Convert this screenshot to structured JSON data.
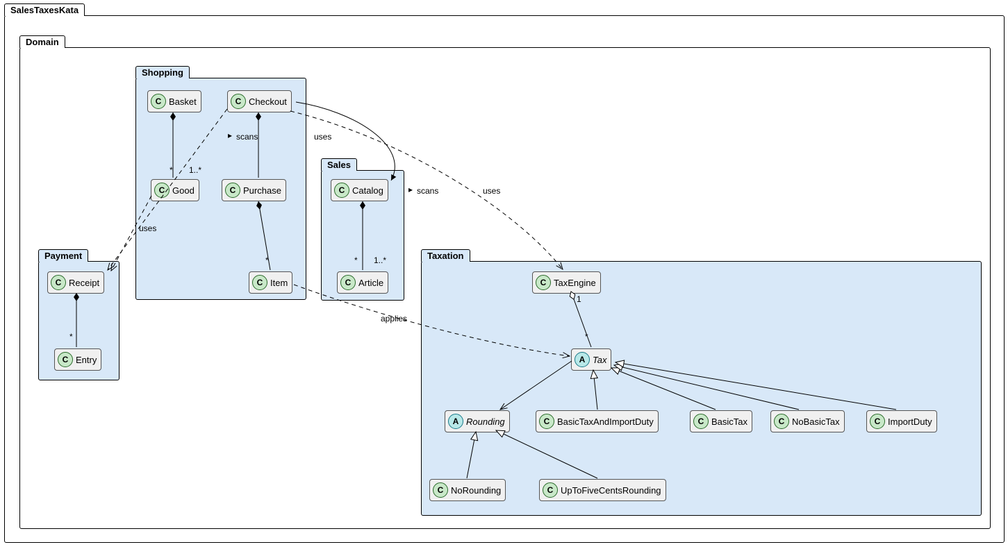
{
  "root_package": "SalesTaxesKata",
  "domain": {
    "label": "Domain"
  },
  "shopping": {
    "label": "Shopping",
    "basket": "Basket",
    "checkout": "Checkout",
    "good": "Good",
    "purchase": "Purchase",
    "item": "Item"
  },
  "sales": {
    "label": "Sales",
    "catalog": "Catalog",
    "article": "Article"
  },
  "payment": {
    "label": "Payment",
    "receipt": "Receipt",
    "entry": "Entry"
  },
  "taxation": {
    "label": "Taxation",
    "taxengine": "TaxEngine",
    "tax": "Tax",
    "rounding": "Rounding",
    "basictaxandimportduty": "BasicTaxAndImportDuty",
    "basictax": "BasicTax",
    "nobasictax": "NoBasicTax",
    "importduty": "ImportDuty",
    "norounding": "NoRounding",
    "upto": "UpToFiveCentsRounding"
  },
  "rel": {
    "scans": "scans",
    "uses": "uses",
    "applies": "applies",
    "star": "*",
    "one_star": "1..*",
    "one": "1"
  },
  "chart_data": {
    "type": "uml_class_diagram",
    "packages": [
      {
        "name": "SalesTaxesKata",
        "children": [
          "Domain"
        ]
      },
      {
        "name": "Domain",
        "children": [
          "Shopping",
          "Sales",
          "Payment",
          "Taxation"
        ]
      },
      {
        "name": "Shopping",
        "classes": [
          "Basket",
          "Checkout",
          "Good",
          "Purchase",
          "Item"
        ]
      },
      {
        "name": "Sales",
        "classes": [
          "Catalog",
          "Article"
        ]
      },
      {
        "name": "Payment",
        "classes": [
          "Receipt",
          "Entry"
        ]
      },
      {
        "name": "Taxation",
        "classes": [
          "TaxEngine",
          "Tax",
          "Rounding",
          "BasicTaxAndImportDuty",
          "BasicTax",
          "NoBasicTax",
          "ImportDuty",
          "NoRounding",
          "UpToFiveCentsRounding"
        ]
      }
    ],
    "abstract_classes": [
      "Tax",
      "Rounding"
    ],
    "relationships": [
      {
        "from": "Basket",
        "to": "Good",
        "type": "composition",
        "from_mult": "",
        "to_mult": "*"
      },
      {
        "from": "Checkout",
        "to": "Purchase",
        "type": "composition",
        "to_mult": "1..*",
        "label": "scans"
      },
      {
        "from": "Purchase",
        "to": "Item",
        "type": "composition",
        "to_mult": "*"
      },
      {
        "from": "Catalog",
        "to": "Article",
        "type": "composition",
        "from_mult": "*",
        "to_mult": "1..*"
      },
      {
        "from": "Receipt",
        "to": "Entry",
        "type": "composition",
        "to_mult": "*"
      },
      {
        "from": "TaxEngine",
        "to": "Tax",
        "type": "aggregation",
        "from_mult": "1",
        "to_mult": "*"
      },
      {
        "from": "Checkout",
        "to": "Catalog",
        "type": "association",
        "label": "scans"
      },
      {
        "from": "Checkout",
        "to": "TaxEngine",
        "type": "dependency",
        "label": "uses"
      },
      {
        "from": "Checkout",
        "to": "Receipt",
        "type": "dependency",
        "label": "uses"
      },
      {
        "from": "Good",
        "to": "Receipt",
        "type": "dependency",
        "label": "uses"
      },
      {
        "from": "Item",
        "to": "Tax",
        "type": "dependency",
        "label": "applies"
      },
      {
        "from": "Tax",
        "to": "Rounding",
        "type": "association_directed"
      },
      {
        "from": "BasicTaxAndImportDuty",
        "to": "Tax",
        "type": "inheritance"
      },
      {
        "from": "BasicTax",
        "to": "Tax",
        "type": "inheritance"
      },
      {
        "from": "NoBasicTax",
        "to": "Tax",
        "type": "inheritance"
      },
      {
        "from": "ImportDuty",
        "to": "Tax",
        "type": "inheritance"
      },
      {
        "from": "NoRounding",
        "to": "Rounding",
        "type": "inheritance"
      },
      {
        "from": "UpToFiveCentsRounding",
        "to": "Rounding",
        "type": "inheritance"
      }
    ]
  }
}
